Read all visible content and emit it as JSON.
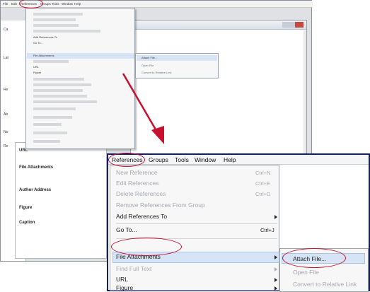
{
  "large_menubar": [
    "References",
    "Groups",
    "Tools",
    "Window",
    "Help"
  ],
  "large_menu": {
    "items": [
      {
        "label": "New Reference",
        "shortcut": "Ctrl+N",
        "enabled": false
      },
      {
        "label": "Edit References",
        "shortcut": "Ctrl+E",
        "enabled": false
      },
      {
        "label": "Delete References",
        "shortcut": "Ctrl+D",
        "enabled": false
      },
      {
        "label": "Remove References From Group",
        "shortcut": "",
        "enabled": false
      },
      {
        "label": "Add References To",
        "shortcut": "",
        "enabled": true
      },
      {
        "label": "Go To...",
        "shortcut": "Ctrl+J",
        "enabled": true
      },
      {
        "label": "File Attachments",
        "shortcut": "",
        "enabled": true
      },
      {
        "label": "Find Full Text",
        "shortcut": "",
        "enabled": false
      },
      {
        "label": "URL",
        "shortcut": "",
        "enabled": true
      },
      {
        "label": "Figure",
        "shortcut": "",
        "enabled": true
      }
    ],
    "submenu": [
      {
        "label": "Attach File...",
        "enabled": true
      },
      {
        "label": "Open File",
        "enabled": false
      },
      {
        "label": "Convert to Relative Link",
        "enabled": false
      }
    ]
  },
  "small_menubar": [
    "File",
    "Edit",
    "References",
    "Groups",
    "Tools",
    "Window",
    "Help"
  ],
  "small_menu": {
    "visible": [
      "Go To...",
      "File Attachments",
      "URL",
      "Figure"
    ],
    "submenu": [
      "Attach File...",
      "Open File",
      "Convert to Relative Link"
    ]
  },
  "small_fields": [
    "URL",
    "File Attachments",
    "Author Address",
    "Figure",
    "Caption"
  ],
  "colors": {
    "annotation_red": "#c8102e",
    "highlight": "#d6e4f5",
    "frame": "#121e6a"
  }
}
